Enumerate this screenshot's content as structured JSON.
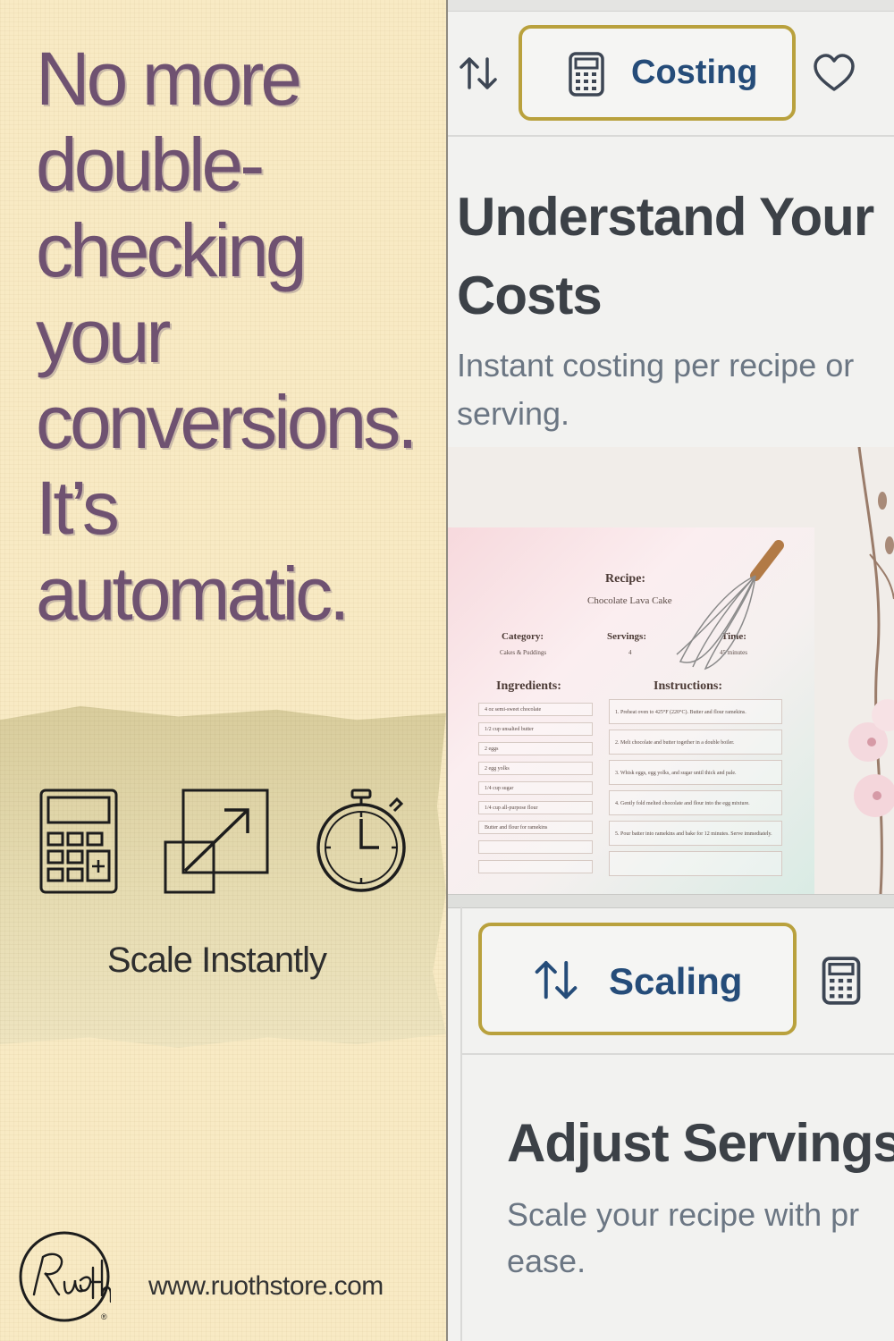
{
  "headline": {
    "lines": [
      "No more",
      "double-",
      "checking",
      "your",
      "conversions.",
      "It’s",
      "automatic."
    ]
  },
  "features": {
    "icons": [
      "calculator-icon",
      "scale-resize-icon",
      "stopwatch-icon"
    ],
    "caption": "Scale Instantly"
  },
  "brand": {
    "logo_text": "Ruoth",
    "registered": "®",
    "url": "www.ruothstore.com"
  },
  "app": {
    "costing_tab": {
      "label": "Costing",
      "icon": "calculator-icon"
    },
    "costing_card": {
      "title_line1": "Understand Your",
      "title_line2": "Costs",
      "desc_line1": "Instant costing per recipe or",
      "desc_line2": "serving."
    },
    "recipe_card": {
      "recipe_label": "Recipe:",
      "recipe_name": "Chocolate Lava Cake",
      "category_label": "Category:",
      "category_value": "Cakes & Puddings",
      "servings_label": "Servings:",
      "servings_value": "4",
      "time_label": "Time:",
      "time_value": "45 minutes",
      "ingredients_label": "Ingredients:",
      "instructions_label": "Instructions:",
      "ingredients": [
        "4 oz semi-sweet chocolate",
        "1/2 cup unsalted butter",
        "2 eggs",
        "2 egg yolks",
        "1/4 cup sugar",
        "1/4 cup all-purpose flour",
        "Butter and flour for ramekins"
      ],
      "instructions": [
        "1. Preheat oven to 425°F (220°C). Butter and flour ramekins.",
        "2. Melt chocolate and butter together in a double boiler.",
        "3. Whisk eggs, egg yolks, and sugar until thick and pale.",
        "4. Gently fold melted chocolate and flour into the egg mixture.",
        "5. Pour batter into ramekins and bake for 12 minutes. Serve immediately."
      ]
    },
    "scaling_tab": {
      "label": "Scaling",
      "icon": "sort-arrows-icon"
    },
    "scaling_card": {
      "title": "Adjust Servings",
      "desc_line1": "Scale your recipe with pr",
      "desc_line2": "ease."
    }
  },
  "colors": {
    "headline": "#6f5271",
    "tab_border": "#b9a13d",
    "tab_text": "#254c79"
  }
}
